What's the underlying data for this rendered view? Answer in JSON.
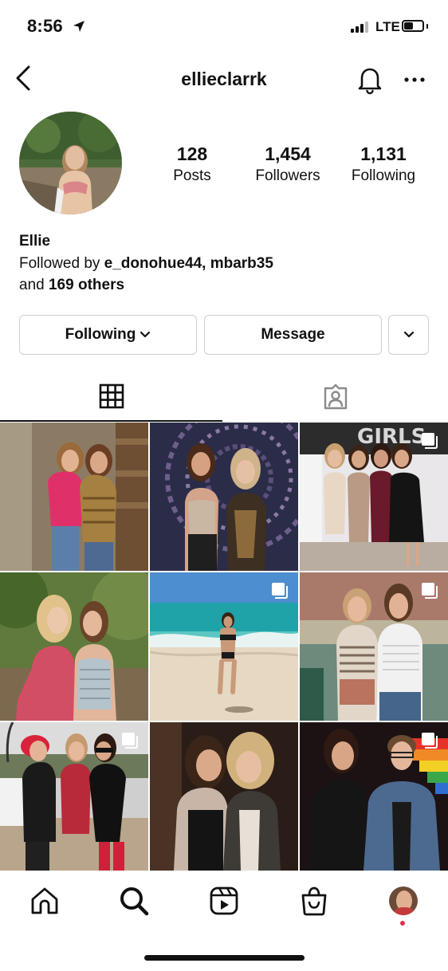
{
  "status_bar": {
    "time": "8:56",
    "network": "LTE"
  },
  "header": {
    "username": "ellieclarrk",
    "back_icon": "chevron-left-icon",
    "bell_icon": "bell-icon",
    "more_icon": "more-horizontal-icon"
  },
  "profile": {
    "stats": [
      {
        "value": "128",
        "label": "Posts"
      },
      {
        "value": "1,454",
        "label": "Followers"
      },
      {
        "value": "1,131",
        "label": "Following"
      }
    ],
    "name": "Ellie",
    "followed_by_prefix": "Followed by ",
    "followed_by_users": "e_donohue44, mbarb35",
    "and_text": "and ",
    "others_text": "169 others"
  },
  "actions": {
    "following_label": "Following",
    "message_label": "Message"
  },
  "tabs": {
    "grid_icon": "grid-icon",
    "tagged_icon": "tagged-person-icon"
  },
  "posts": [
    {
      "id": 1,
      "multi": false
    },
    {
      "id": 2,
      "multi": false
    },
    {
      "id": 3,
      "multi": true,
      "overlay_text": "GIRLS"
    },
    {
      "id": 4,
      "multi": false
    },
    {
      "id": 5,
      "multi": true
    },
    {
      "id": 6,
      "multi": true
    },
    {
      "id": 7,
      "multi": true
    },
    {
      "id": 8,
      "multi": false
    },
    {
      "id": 9,
      "multi": true
    }
  ],
  "bottom_nav": [
    "home-icon",
    "search-icon",
    "reels-icon",
    "shop-icon",
    "profile-avatar"
  ],
  "colors": {
    "text": "#111111",
    "border": "#cfcfcf",
    "notification_dot": "#e0314a"
  }
}
